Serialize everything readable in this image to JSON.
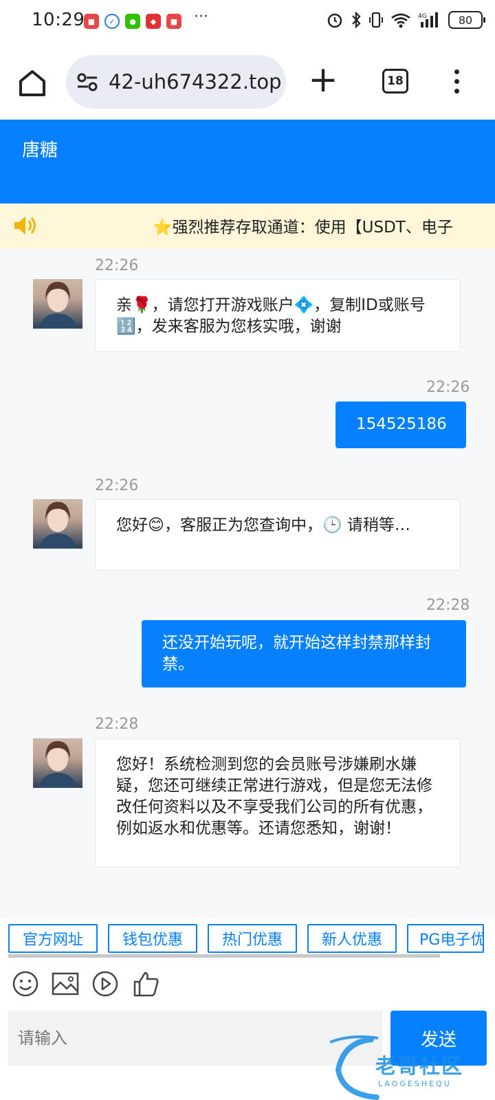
{
  "status_bar": {
    "time": "10:29",
    "battery": "80",
    "overflow": "···",
    "network": "4G"
  },
  "browser": {
    "url": "42-uh674322.top",
    "tab_count": "18"
  },
  "header": {
    "title": "唐糖"
  },
  "notice": {
    "text": "⭐强烈推荐存取通道：使用【USDT、电子"
  },
  "messages": [
    {
      "from": "agent",
      "time": "22:26",
      "text": "亲🌹，请您打开游戏账户💠，复制ID或账号🔢，发来客服为您核实哦，谢谢"
    },
    {
      "from": "user",
      "time": "22:26",
      "text": "154525186"
    },
    {
      "from": "agent",
      "time": "22:26",
      "text": "您好😊，客服正为您查询中，🕒 请稍等…"
    },
    {
      "from": "user",
      "time": "22:28",
      "text": "还没开始玩呢，就开始这样封禁那样封禁。"
    },
    {
      "from": "agent",
      "time": "22:28",
      "text": "您好！系统检测到您的会员账号涉嫌刷水嫌疑，您还可继续正常进行游戏，但是您无法修改任何资料以及不享受我们公司的所有优惠，例如返水和优惠等。还请您悉知，谢谢！"
    }
  ],
  "quick_buttons": [
    "官方网址",
    "钱包优惠",
    "热门优惠",
    "新人优惠",
    "PG电子优"
  ],
  "tools": [
    "smile-icon",
    "image-icon",
    "play-icon",
    "thumbs-up-icon"
  ],
  "composer": {
    "placeholder": "请输入",
    "send_label": "发送"
  },
  "watermark": {
    "text": "老哥社区",
    "sub": "LAOGESHEQU"
  },
  "colors": {
    "brand_blue": "#0780fe",
    "notice_bg": "#fdf6d8",
    "chat_bg": "#f7f8fa"
  }
}
